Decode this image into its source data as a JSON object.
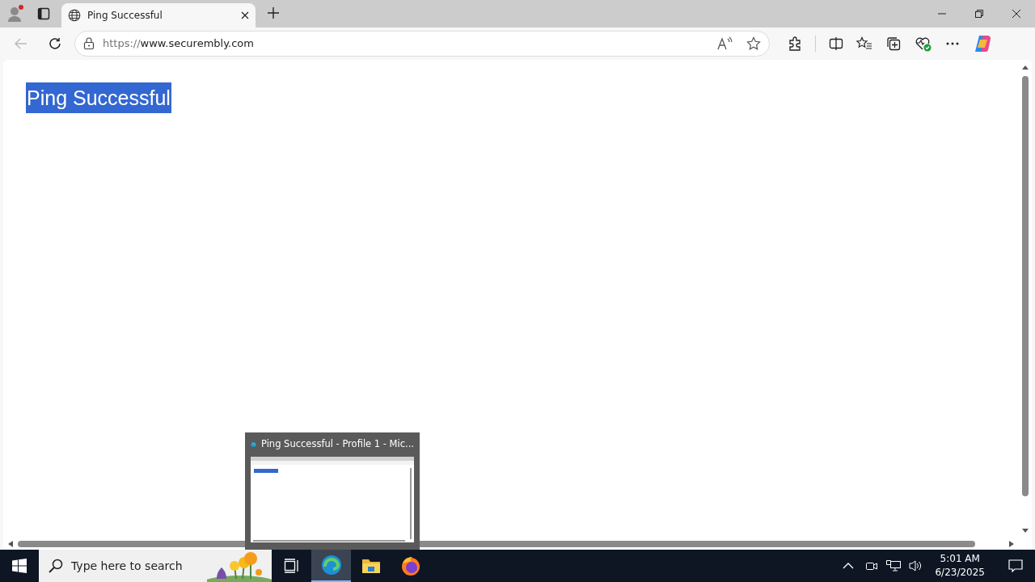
{
  "browser": {
    "tabs": [
      {
        "title": "Ping Successful",
        "selected": true
      }
    ],
    "address": "https://www.securembly.com"
  },
  "page": {
    "heading": "Ping Successful",
    "heading_selected": true
  },
  "taskbar": {
    "search_placeholder": "Type here to search",
    "apps": [
      {
        "kind": "task-view",
        "active": false
      },
      {
        "kind": "edge",
        "active": true
      },
      {
        "kind": "explorer",
        "active": false
      },
      {
        "kind": "firefox",
        "active": false
      }
    ],
    "time": "5:01 AM",
    "date": "6/23/2025"
  },
  "thumbnail_preview": {
    "title": "Ping Successful - Profile 1 - Mic..."
  }
}
